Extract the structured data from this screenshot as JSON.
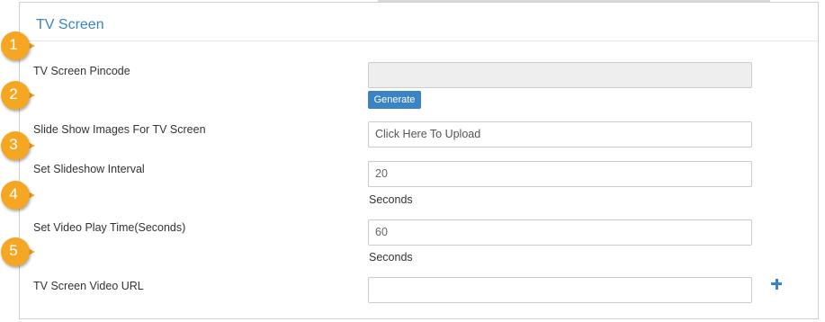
{
  "panel": {
    "title": "TV Screen"
  },
  "form": {
    "pincode": {
      "label": "TV Screen Pincode",
      "value": "",
      "button": "Generate"
    },
    "slideshow_images": {
      "label": "Slide Show Images For TV Screen",
      "placeholder": "Click Here To Upload"
    },
    "slideshow_interval": {
      "label": "Set Slideshow Interval",
      "value": "20",
      "unit": "Seconds"
    },
    "video_play_time": {
      "label": "Set Video Play Time(Seconds)",
      "value": "60",
      "unit": "Seconds"
    },
    "video_url": {
      "label": "TV Screen Video URL",
      "value": "",
      "add_icon": "plus-icon"
    }
  },
  "markers": [
    "1",
    "2",
    "3",
    "4",
    "5"
  ],
  "colors": {
    "accent": "#3a83c4",
    "marker": "#f5a623"
  }
}
